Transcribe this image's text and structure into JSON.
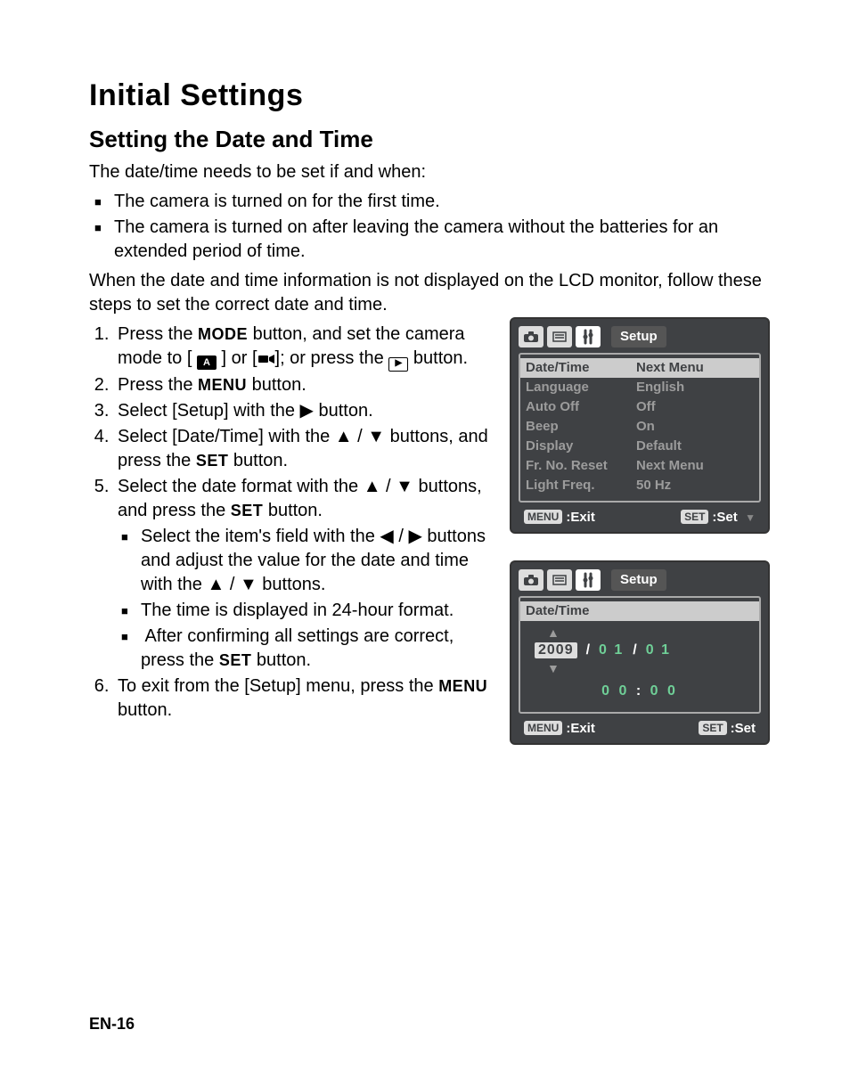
{
  "title": "Initial Settings",
  "subtitle": "Setting the Date and Time",
  "intro": "The date/time needs to be set if and when:",
  "intro_bullets": [
    "The camera is turned on for the first time.",
    "The camera is turned on after leaving the camera without the batteries for an extended period of time."
  ],
  "intro2": "When the date and time information is not displayed on the LCD monitor, follow these steps to set the correct date and time.",
  "labels": {
    "mode": "MODE",
    "menu": "MENU",
    "set": "SET"
  },
  "steps": {
    "s1a": "Press the ",
    "s1b": " button, and set the camera mode to [ ",
    "s1c": " ] or [",
    "s1d": "]; or press the ",
    "s1e": " button.",
    "s2a": "Press the ",
    "s2b": " button.",
    "s3": "Select [Setup] with the  ▶  button.",
    "s4a": "Select [Date/Time] with the  ▲ / ▼  buttons, and press the ",
    "s4b": " button.",
    "s5a": "Select the date format with the  ▲ / ▼  buttons, and press the ",
    "s5b": " button.",
    "s5_inner": [
      "Select the item's field with the  ◀ / ▶  buttons and adjust the value for the date and time with the  ▲ / ▼  buttons.",
      "The time is displayed in 24-hour format.",
      "After confirming all settings are correct, press the "
    ],
    "s5_inner_tail": " button.",
    "s6a": "To exit from the [Setup] menu, press the ",
    "s6b": " button."
  },
  "lcd1": {
    "tab_label": "Setup",
    "rows": [
      {
        "k": "Date/Time",
        "v": "Next Menu",
        "selected": true
      },
      {
        "k": "Language",
        "v": "English"
      },
      {
        "k": "Auto Off",
        "v": "Off"
      },
      {
        "k": "Beep",
        "v": "On"
      },
      {
        "k": "Display",
        "v": "Default"
      },
      {
        "k": "Fr. No. Reset",
        "v": "Next Menu"
      },
      {
        "k": "Light Freq.",
        "v": "50 Hz"
      }
    ],
    "exit": ":Exit",
    "set": ":Set"
  },
  "lcd2": {
    "tab_label": "Setup",
    "header": "Date/Time",
    "year": "2009",
    "month": "0 1",
    "day": "0 1",
    "hour": "0 0",
    "minute": "0 0",
    "exit": ":Exit",
    "set": ":Set"
  },
  "footer": "EN-16"
}
